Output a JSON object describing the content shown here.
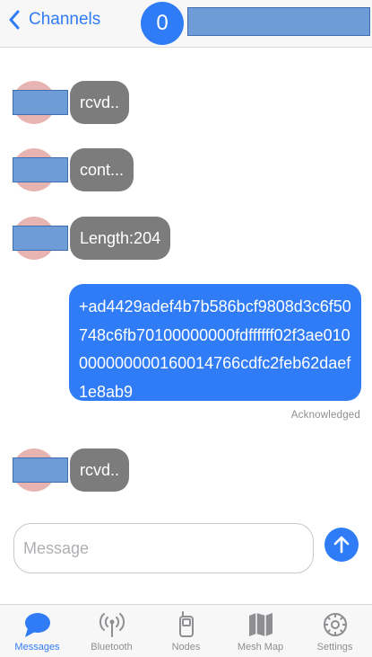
{
  "header": {
    "back_label": "Channels",
    "channel_number": "0"
  },
  "messages": [
    {
      "direction": "in",
      "text": "rcvd.."
    },
    {
      "direction": "in",
      "text": "cont..."
    },
    {
      "direction": "in",
      "text": "Length:204"
    },
    {
      "direction": "out",
      "text": "+ad4429adef4b7b586bcf9808d3c6f50748c6fb70100000000fdffffff02f3ae010000000000160014766cdfc2feb62daef1e8ab9",
      "status": "Acknowledged"
    },
    {
      "direction": "in",
      "text": "rcvd.."
    }
  ],
  "composer": {
    "placeholder": "Message",
    "value": ""
  },
  "tabs": [
    {
      "label": "Messages",
      "icon": "chat-bubble-icon",
      "active": true
    },
    {
      "label": "Bluetooth",
      "icon": "antenna-icon",
      "active": false
    },
    {
      "label": "Nodes",
      "icon": "handheld-device-icon",
      "active": false
    },
    {
      "label": "Mesh Map",
      "icon": "map-icon",
      "active": false
    },
    {
      "label": "Settings",
      "icon": "gear-icon",
      "active": false
    }
  ],
  "colors": {
    "accent": "#2f7cf6",
    "incoming_bubble": "#7c7c7c",
    "avatar": "#e8b4b1",
    "redaction": "#6f9bd6"
  }
}
